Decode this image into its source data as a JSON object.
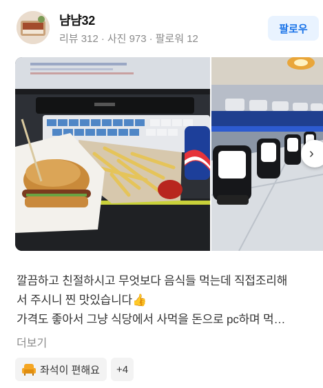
{
  "reviewer": {
    "name": "냠냠32",
    "stats": [
      {
        "label": "리뷰",
        "value": "312"
      },
      {
        "label": "사진",
        "value": "973"
      },
      {
        "label": "팔로워",
        "value": "12"
      }
    ],
    "stats_separator": "·",
    "avatar_icon": "food-photo-avatar"
  },
  "follow_button": {
    "label": "팔로우",
    "color": "#1a73e8",
    "background": "#e9f3ff"
  },
  "photos": [
    {
      "icon": "burger-fries-pc-desk-photo"
    },
    {
      "icon": "pc-room-gaming-chairs-photo"
    }
  ],
  "next_button": {
    "icon": "chevron-right-icon",
    "glyph": "›"
  },
  "review": {
    "lines": [
      "깔끔하고 친절하시고 무엇보다 음식들 먹는데 직접조리해",
      "서 주시니 찐 맛있습니다👍",
      "가격도 좋아서 그냥 식당에서 사먹을 돈으로 pc하며 먹…"
    ],
    "more_label": "더보기"
  },
  "tags": [
    {
      "label": "좌석이 편해요",
      "icon": "armchair-icon",
      "icon_color": "#f5a623"
    },
    {
      "label": "+4"
    }
  ]
}
